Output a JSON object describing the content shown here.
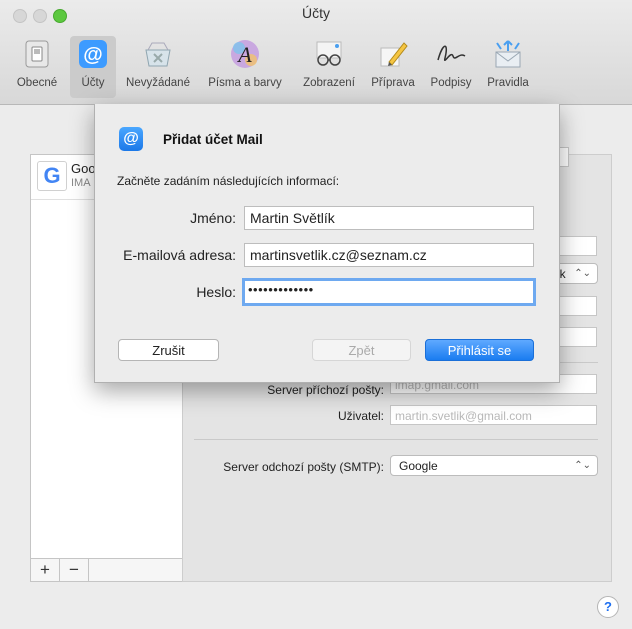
{
  "window": {
    "title": "Účty"
  },
  "toolbar": {
    "items": [
      {
        "label": "Obecné",
        "icon": "switch-icon"
      },
      {
        "label": "Účty",
        "icon": "at-sign-icon"
      },
      {
        "label": "Nevyžádané",
        "icon": "junk-tray-icon"
      },
      {
        "label": "Písma a barvy",
        "icon": "font-icon"
      },
      {
        "label": "Zobrazení",
        "icon": "glasses-icon"
      },
      {
        "label": "Příprava",
        "icon": "pencil-icon"
      },
      {
        "label": "Podpisy",
        "icon": "signature-icon"
      },
      {
        "label": "Pravidla",
        "icon": "rules-envelope-icon"
      }
    ],
    "active_index": 1
  },
  "accounts_list": {
    "items": [
      {
        "name": "Goo",
        "type": "IMA"
      }
    ],
    "add_label": "+",
    "remove_label": "−"
  },
  "detail": {
    "partial_popup_text": "tlik",
    "incoming_server_label": "Server příchozí pošty:",
    "incoming_server_value": "imap.gmail.com",
    "user_label": "Uživatel:",
    "user_value": "martin.svetlik@gmail.com",
    "smtp_label": "Server odchozí pošty (SMTP):",
    "smtp_value": "Google"
  },
  "sheet": {
    "title": "Přidat účet Mail",
    "subtitle": "Začněte zadáním následujících informací:",
    "name_label": "Jméno:",
    "name_value": "Martin Světlík",
    "email_label": "E-mailová adresa:",
    "email_value": "martinsvetlik.cz@seznam.cz",
    "password_label": "Heslo:",
    "password_value": "•••••••••••••",
    "cancel_label": "Zrušit",
    "back_label": "Zpět",
    "login_label": "Přihlásit se"
  },
  "help_label": "?",
  "colors": {
    "accent": "#1a7cf0",
    "focus_ring": "#6ea9f0"
  }
}
